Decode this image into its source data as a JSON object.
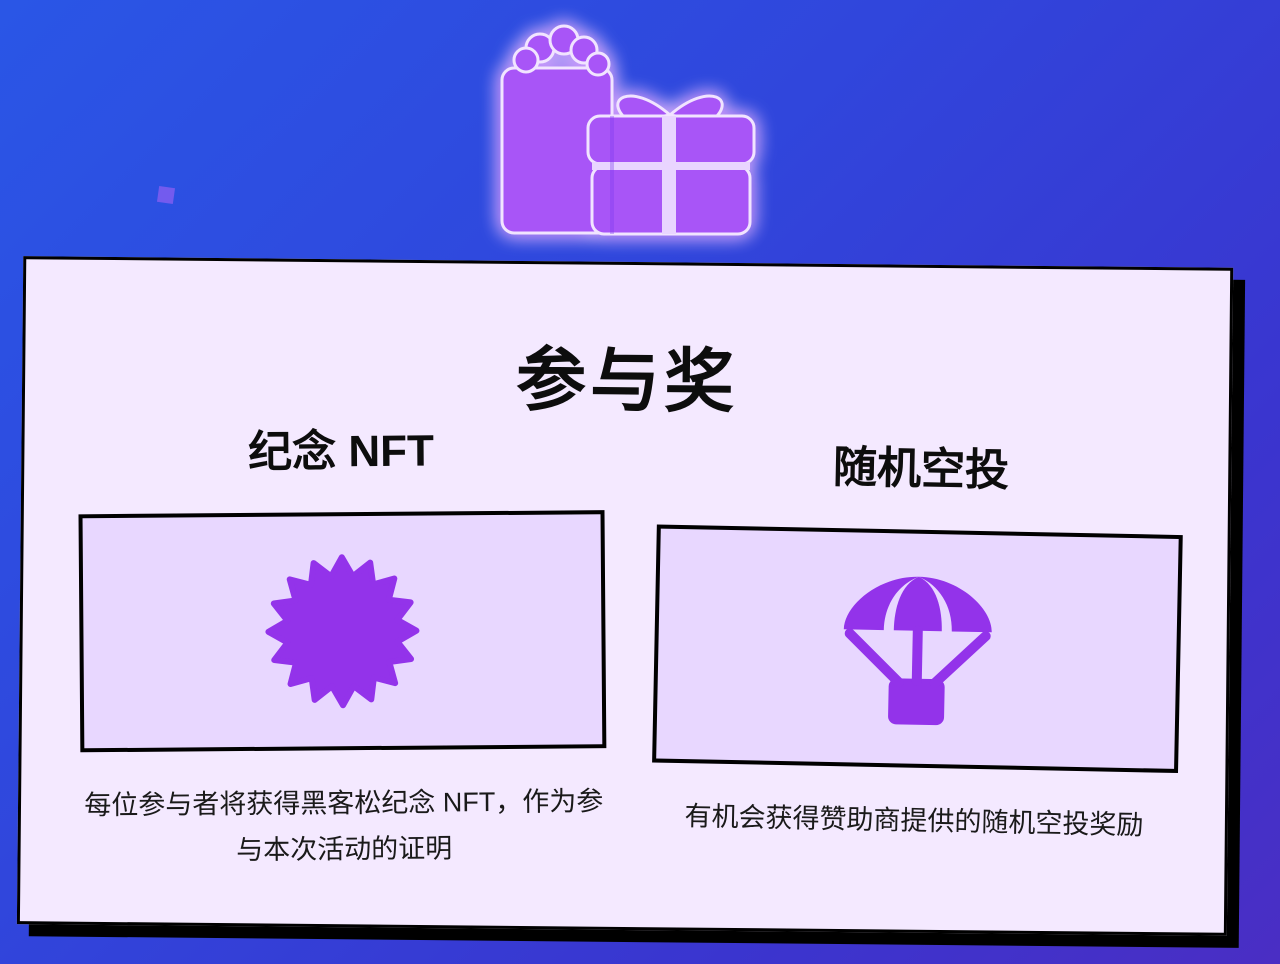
{
  "section": {
    "title": "参与奖"
  },
  "prizes": [
    {
      "title": "纪念 NFT",
      "icon": "badge-icon",
      "description": "每位参与者将获得黑客松纪念 NFT，作为参与本次活动的证明"
    },
    {
      "title": "随机空投",
      "icon": "parachute-icon",
      "description": "有机会获得赞助商提供的随机空投奖励"
    }
  ],
  "colors": {
    "accent": "#9333ea",
    "card_background": "#f4e9ff",
    "tile_background": "#e8d7ff",
    "gift_fill": "#a855f7"
  },
  "hero": {
    "icon": "gifts-icon"
  }
}
